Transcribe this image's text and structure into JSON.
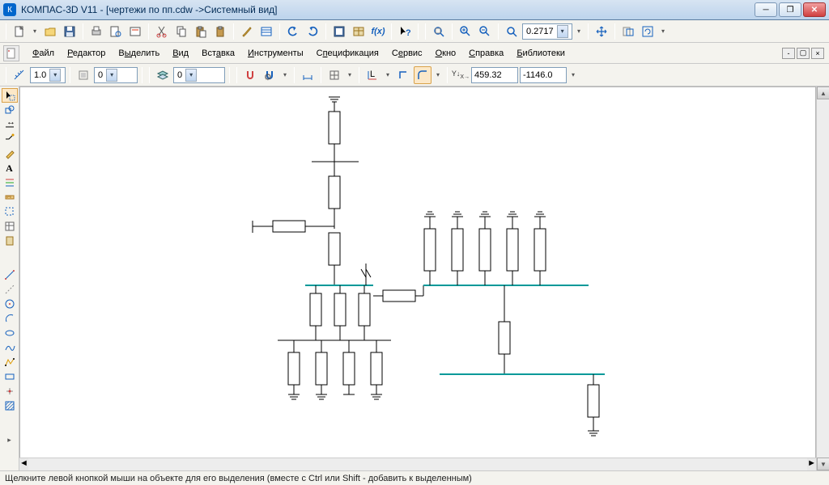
{
  "title": "КОМПАС-3D V11 - [чертежи по пп.cdw ->Системный вид]",
  "menus": {
    "file": "Файл",
    "editor": "Редактор",
    "select": "Выделить",
    "view": "Вид",
    "insert": "Вставка",
    "tools": "Инструменты",
    "spec": "Спецификация",
    "service": "Сервис",
    "window": "Окно",
    "help": "Справка",
    "lib": "Библиотеки"
  },
  "zoom": "0.2717",
  "tb2": {
    "scale": "1.0",
    "state": "0",
    "layer": "0",
    "x": "459.32",
    "y": "-1146.0"
  },
  "status": "Щелкните левой кнопкой мыши на объекте для его выделения (вместе с Ctrl или Shift - добавить к выделенным)"
}
